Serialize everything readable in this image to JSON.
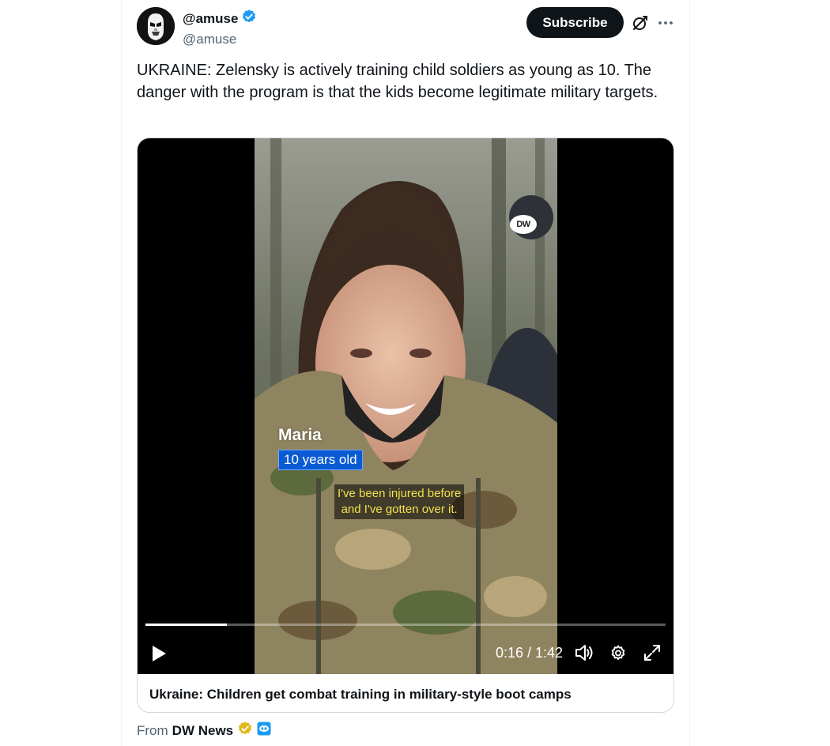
{
  "post": {
    "display_name": "@amuse",
    "handle": "@amuse",
    "text": "UKRAINE: Zelensky is actively training child soldiers as young as 10. The danger with the program is that the kids become legitimate military targets."
  },
  "header": {
    "subscribe_label": "Subscribe"
  },
  "video": {
    "watermark": "DW",
    "caption_name": "Maria",
    "caption_age": "10 years old",
    "subtitle_line1": "I've been injured before",
    "subtitle_line2": "and I've gotten over it.",
    "time_display": "0:16 / 1:42",
    "progress": 0.157
  },
  "card": {
    "title": "Ukraine: Children get combat training in military-style boot camps"
  },
  "source": {
    "from_label": "From",
    "name": "DW News"
  },
  "colors": {
    "verified_blue": "#1d9bf0",
    "verified_gold": "#e2b719",
    "caption_blue": "#0a5bd3",
    "subtitle_yellow": "#f2e24b"
  },
  "icons": [
    "verified-badge-icon",
    "grok-icon",
    "more-icon",
    "play-icon",
    "volume-icon",
    "settings-icon",
    "fullscreen-icon",
    "affiliate-badge-icon"
  ]
}
